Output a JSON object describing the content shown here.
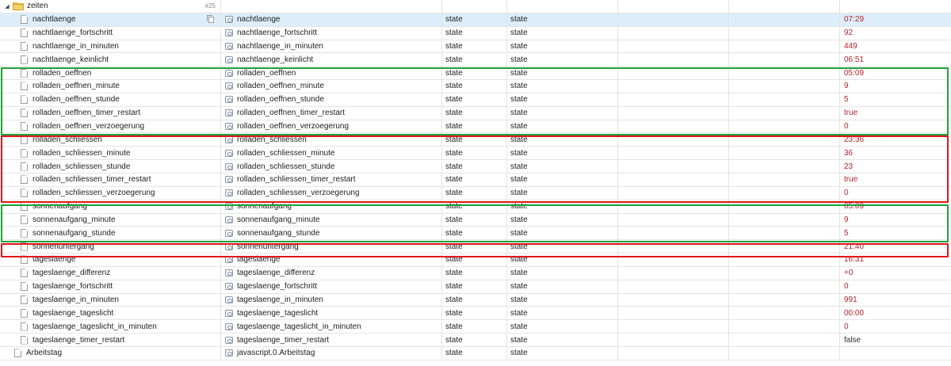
{
  "folder": {
    "name": "zeiten",
    "badge": "#25"
  },
  "rows": [
    {
      "name": "nachtlaenge",
      "id": "nachtlaenge",
      "role": "state",
      "type": "state",
      "value": "07:29",
      "selected": true
    },
    {
      "name": "nachtlaenge_fortschritt",
      "id": "nachtlaenge_fortschritt",
      "role": "state",
      "type": "state",
      "value": "92"
    },
    {
      "name": "nachtlaenge_in_minuten",
      "id": "nachtlaenge_in_minuten",
      "role": "state",
      "type": "state",
      "value": "449"
    },
    {
      "name": "nachtlaenge_keinlicht",
      "id": "nachtlaenge_keinlicht",
      "role": "state",
      "type": "state",
      "value": "06:51"
    },
    {
      "name": "rolladen_oeffnen",
      "id": "rolladen_oeffnen",
      "role": "state",
      "type": "state",
      "value": "05:09"
    },
    {
      "name": "rolladen_oeffnen_minute",
      "id": "rolladen_oeffnen_minute",
      "role": "state",
      "type": "state",
      "value": "9"
    },
    {
      "name": "rolladen_oeffnen_stunde",
      "id": "rolladen_oeffnen_stunde",
      "role": "state",
      "type": "state",
      "value": "5"
    },
    {
      "name": "rolladen_oeffnen_timer_restart",
      "id": "rolladen_oeffnen_timer_restart",
      "role": "state",
      "type": "state",
      "value": "true"
    },
    {
      "name": "rolladen_oeffnen_verzoegerung",
      "id": "rolladen_oeffnen_verzoegerung",
      "role": "state",
      "type": "state",
      "value": "0"
    },
    {
      "name": "rolladen_schliessen",
      "id": "rolladen_schliessen",
      "role": "state",
      "type": "state",
      "value": "23:36"
    },
    {
      "name": "rolladen_schliessen_minute",
      "id": "rolladen_schliessen_minute",
      "role": "state",
      "type": "state",
      "value": "36"
    },
    {
      "name": "rolladen_schliessen_stunde",
      "id": "rolladen_schliessen_stunde",
      "role": "state",
      "type": "state",
      "value": "23"
    },
    {
      "name": "rolladen_schliessen_timer_restart",
      "id": "rolladen_schliessen_timer_restart",
      "role": "state",
      "type": "state",
      "value": "true"
    },
    {
      "name": "rolladen_schliessen_verzoegerung",
      "id": "rolladen_schliessen_verzoegerung",
      "role": "state",
      "type": "state",
      "value": "0"
    },
    {
      "name": "sonnenaufgang",
      "id": "sonnenaufgang",
      "role": "state",
      "type": "state",
      "value": "05:09"
    },
    {
      "name": "sonnenaufgang_minute",
      "id": "sonnenaufgang_minute",
      "role": "state",
      "type": "state",
      "value": "9"
    },
    {
      "name": "sonnenaufgang_stunde",
      "id": "sonnenaufgang_stunde",
      "role": "state",
      "type": "state",
      "value": "5"
    },
    {
      "name": "sonnenuntergang",
      "id": "sonnenuntergang",
      "role": "state",
      "type": "state",
      "value": "21:40"
    },
    {
      "name": "tageslaenge",
      "id": "tageslaenge",
      "role": "state",
      "type": "state",
      "value": "16:31"
    },
    {
      "name": "tageslaenge_differenz",
      "id": "tageslaenge_differenz",
      "role": "state",
      "type": "state",
      "value": "+0"
    },
    {
      "name": "tageslaenge_fortschritt",
      "id": "tageslaenge_fortschritt",
      "role": "state",
      "type": "state",
      "value": "0"
    },
    {
      "name": "tageslaenge_in_minuten",
      "id": "tageslaenge_in_minuten",
      "role": "state",
      "type": "state",
      "value": "991"
    },
    {
      "name": "tageslaenge_tageslicht",
      "id": "tageslaenge_tageslicht",
      "role": "state",
      "type": "state",
      "value": "00:00"
    },
    {
      "name": "tageslaenge_tageslicht_in_minuten",
      "id": "tageslaenge_tageslicht_in_minuten",
      "role": "state",
      "type": "state",
      "value": "0"
    },
    {
      "name": "tageslaenge_timer_restart",
      "id": "tageslaenge_timer_restart",
      "role": "state",
      "type": "state",
      "value": "false",
      "plain": true
    },
    {
      "name": "Arbeitstag",
      "id": "javascript.0.Arbeitstag",
      "role": "state",
      "type": "state",
      "value": "",
      "top_level": true
    }
  ],
  "highlight_colors": {
    "green": "#1fa13a",
    "red": "#e0161c"
  }
}
